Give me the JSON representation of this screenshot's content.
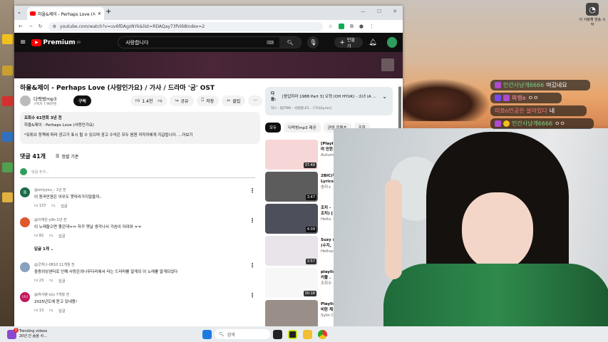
{
  "browser": {
    "tab_title": "하울&제이 - Perhaps Love (사",
    "new_tab": "+",
    "url": "youtube.com/watch?v=uv6fDAgzNYk&list=RDAQay73fVi68index=2"
  },
  "youtube": {
    "logo": "Premium",
    "logo_badge": "KR",
    "search_value": "사랑합니다",
    "create_label": "만들기",
    "video": {
      "title": "하울&제이 - Perhaps Love (사랑인가요) / 가사 / 드라마 '궁' OST",
      "channel": "다락방mp3",
      "subscribers": "구독자 7.96만명",
      "subscribe": "구독",
      "likes": "1.4천",
      "share": "공유",
      "save": "저장",
      "clip": "클립",
      "more": "···"
    },
    "description": {
      "stats": "조회수 61만회  3년 전",
      "line1": "하울&제이 - Perhaps Love (사랑인가요)",
      "line2": "*유튜브 정책에 따라 광고가 표시 될 수 있으며 광고 수익은 모두 음원 저작자에게 지급됩니다. ...더보기"
    },
    "comments_header": {
      "count": "댓글 41개",
      "sort": "정렬 기준",
      "add_placeholder": "댓글 추가..."
    },
    "comments": [
      {
        "author": "@onlyyou_-",
        "time": "1년 전",
        "text": "이 원곡만큼은 아무도 못따라가지않을까..",
        "likes": "137",
        "reply": "답글",
        "avatar": "B",
        "color": "#1e6b4a"
      },
      {
        "author": "@이재은-y9n",
        "time": "1년 전",
        "text": "이 노래들으면 좋은데ㅠㅠ 자꾸 옛날 생각나서 가슴이 아려와 ㅠㅠ",
        "likes": "82",
        "reply": "답글",
        "avatar": "",
        "color": "#e0562e",
        "replies": "답글 1개"
      },
      {
        "author": "@굿하나-0810",
        "time": "11개월 전",
        "text": "중증외상센터로 인해 사랑은외나무다리에서 라는 드라마를 알게되 이 노래를 알게되었다",
        "likes": "23",
        "reply": "답글",
        "avatar": "",
        "color": "#8aa0c0"
      },
      {
        "author": "@여서령-s1s",
        "time": "7개월 전",
        "text": "2025년도에 듣고 있네용!",
        "likes": "13",
        "reply": "답글",
        "avatar": "나나",
        "color": "#c2185b"
      }
    ],
    "up_next": {
      "label": "다음:",
      "title": "[응답하라 1988 Part 3] 오혁 (OH HYUK) - 소녀 (A ...",
      "subtitle": "믹스 - 팀(TIM) - 사랑합니다... [가사/Lyrics]"
    },
    "chips": [
      "모두",
      "다락방mp3 제공",
      "관련 콘텐츠",
      "조회"
    ],
    "recommended": [
      {
        "title": "[Playlist]",
        "line2": "며 만한",
        "channel": "Autumn",
        "duration": "37:49",
        "color": "#f6d6d6"
      },
      {
        "title": "2BIC(투",
        "line2": "Lyrics]",
        "channel": "솜리+",
        "duration": "3:47",
        "color": "#5c5c5c"
      },
      {
        "title": "조치 -",
        "line2": "조치) [",
        "channel": "Hello, M",
        "duration": "4:09",
        "color": "#4d4f5a"
      },
      {
        "title": "Suzy &",
        "line2": "(수지,",
        "channel": "Helloye",
        "duration": "3:57",
        "color": "#e9e3ea"
      },
      {
        "title": "playlist",
        "line2": "커플 .",
        "channel": "조회수",
        "duration": "30:18",
        "color": "#f7f7f7"
      },
      {
        "title": "Playlis",
        "line2": "비란 제",
        "channel": "Sylin D",
        "duration": "",
        "color": "#9a8f88"
      }
    ]
  },
  "chat": [
    {
      "user": "인간사냥개6666",
      "msg": "여깄네요",
      "user_color": "#7ad38a"
    },
    {
      "user": "파랭e",
      "msg": "ㅇㅇ",
      "user_color": "#ff8fb0"
    },
    {
      "user": "미쬬o인궁은 살아있다",
      "msg": "네",
      "user_color": "#ff7a7a"
    },
    {
      "user": "인간사냥개6666",
      "msg": "ㅇㅇ",
      "user_color": "#7ad38a"
    }
  ],
  "overlay_widget": {
    "label": "이 사랑해 방송 시작"
  },
  "taskbar": {
    "news_title": "Trending videos",
    "news_sub": "20년 간 숨을 사...",
    "news_badge": "1",
    "search_placeholder": "검색"
  }
}
